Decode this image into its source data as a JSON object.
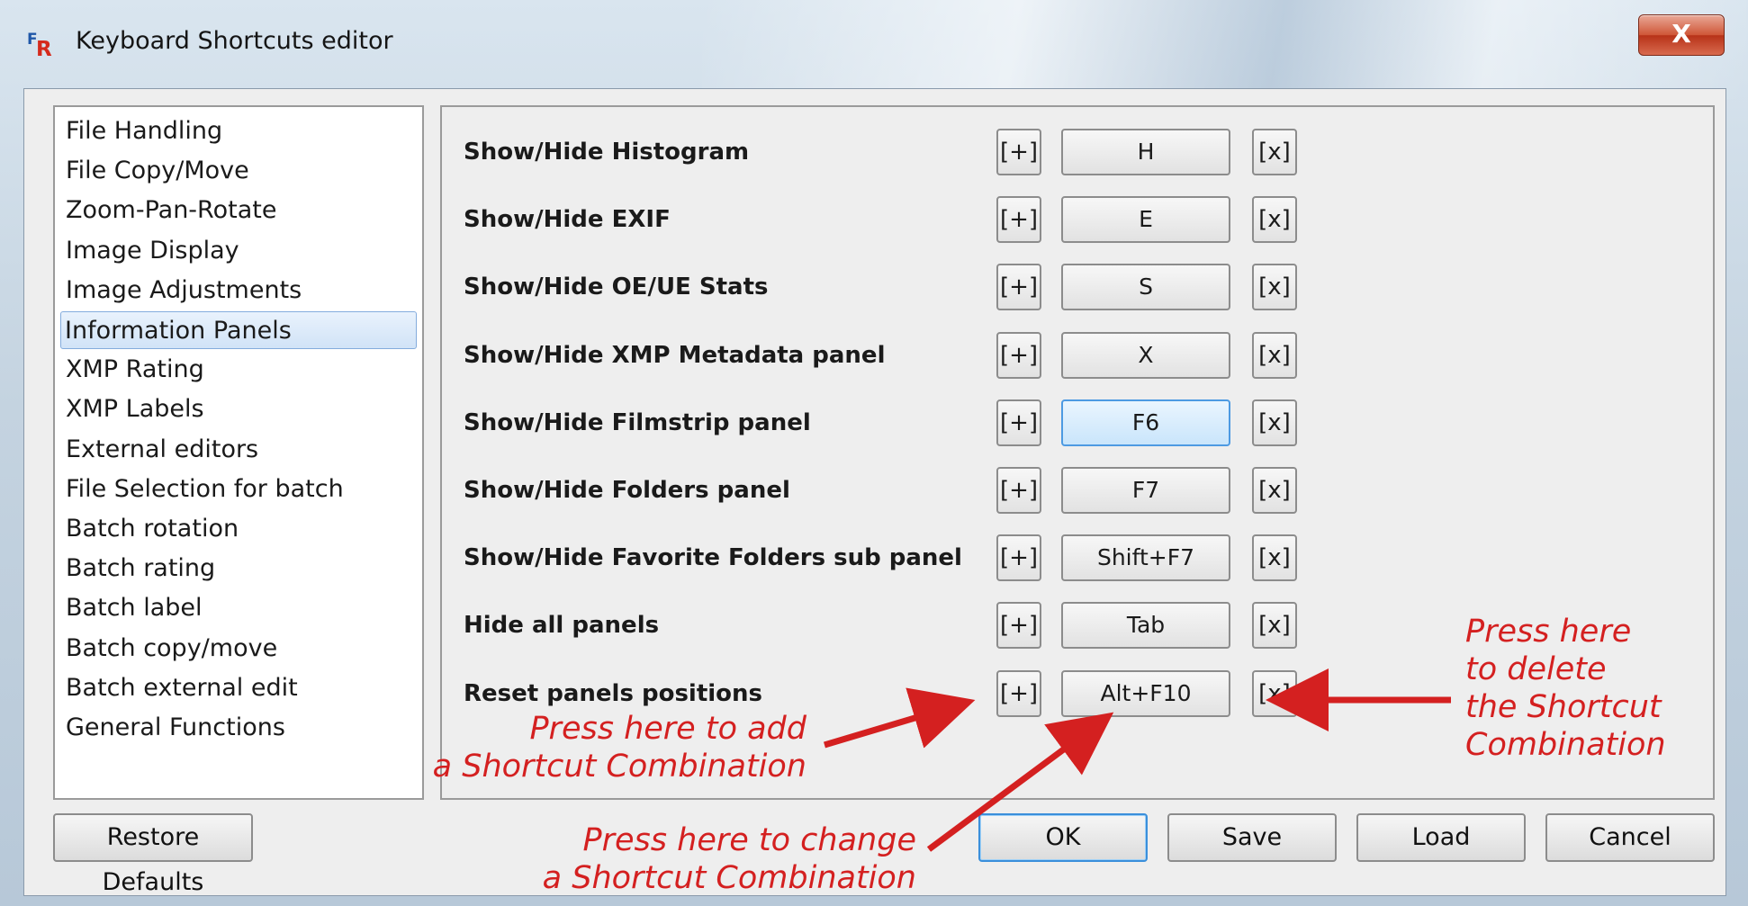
{
  "window": {
    "title": "Keyboard Shortcuts editor",
    "close_label": "X"
  },
  "categories": [
    "File Handling",
    "File Copy/Move",
    "Zoom-Pan-Rotate",
    "Image Display",
    "Image Adjustments",
    "Information Panels",
    "XMP Rating",
    "XMP Labels",
    "External editors",
    "File Selection for batch",
    "Batch rotation",
    "Batch rating",
    "Batch label",
    "Batch copy/move",
    "Batch external edit",
    "General Functions"
  ],
  "selected_category": "Information Panels",
  "shortcuts": [
    {
      "label": "Show/Hide Histogram",
      "key": "H",
      "add": "[+]",
      "del": "[x]"
    },
    {
      "label": "Show/Hide EXIF",
      "key": "E",
      "add": "[+]",
      "del": "[x]"
    },
    {
      "label": "Show/Hide OE/UE Stats",
      "key": "S",
      "add": "[+]",
      "del": "[x]"
    },
    {
      "label": "Show/Hide XMP Metadata panel",
      "key": "X",
      "add": "[+]",
      "del": "[x]"
    },
    {
      "label": "Show/Hide Filmstrip panel",
      "key": "F6",
      "add": "[+]",
      "del": "[x]"
    },
    {
      "label": "Show/Hide Folders panel",
      "key": "F7",
      "add": "[+]",
      "del": "[x]"
    },
    {
      "label": "Show/Hide Favorite Folders sub panel",
      "key": "Shift+F7",
      "add": "[+]",
      "del": "[x]"
    },
    {
      "label": "Hide all panels",
      "key": "Tab",
      "add": "[+]",
      "del": "[x]"
    },
    {
      "label": "Reset panels positions",
      "key": "Alt+F10",
      "add": "[+]",
      "del": "[x]"
    }
  ],
  "focused_key": "F6",
  "buttons": {
    "restore": "Restore Defaults",
    "ok": "OK",
    "save": "Save",
    "load": "Load",
    "cancel": "Cancel"
  },
  "annotations": {
    "add": [
      "Press here to add",
      "a Shortcut Combination"
    ],
    "change": [
      "Press here to change",
      "a Shortcut Combination"
    ],
    "delete": [
      "Press here",
      "to delete",
      "the Shortcut",
      "Combination"
    ],
    "color": "#d42020"
  }
}
